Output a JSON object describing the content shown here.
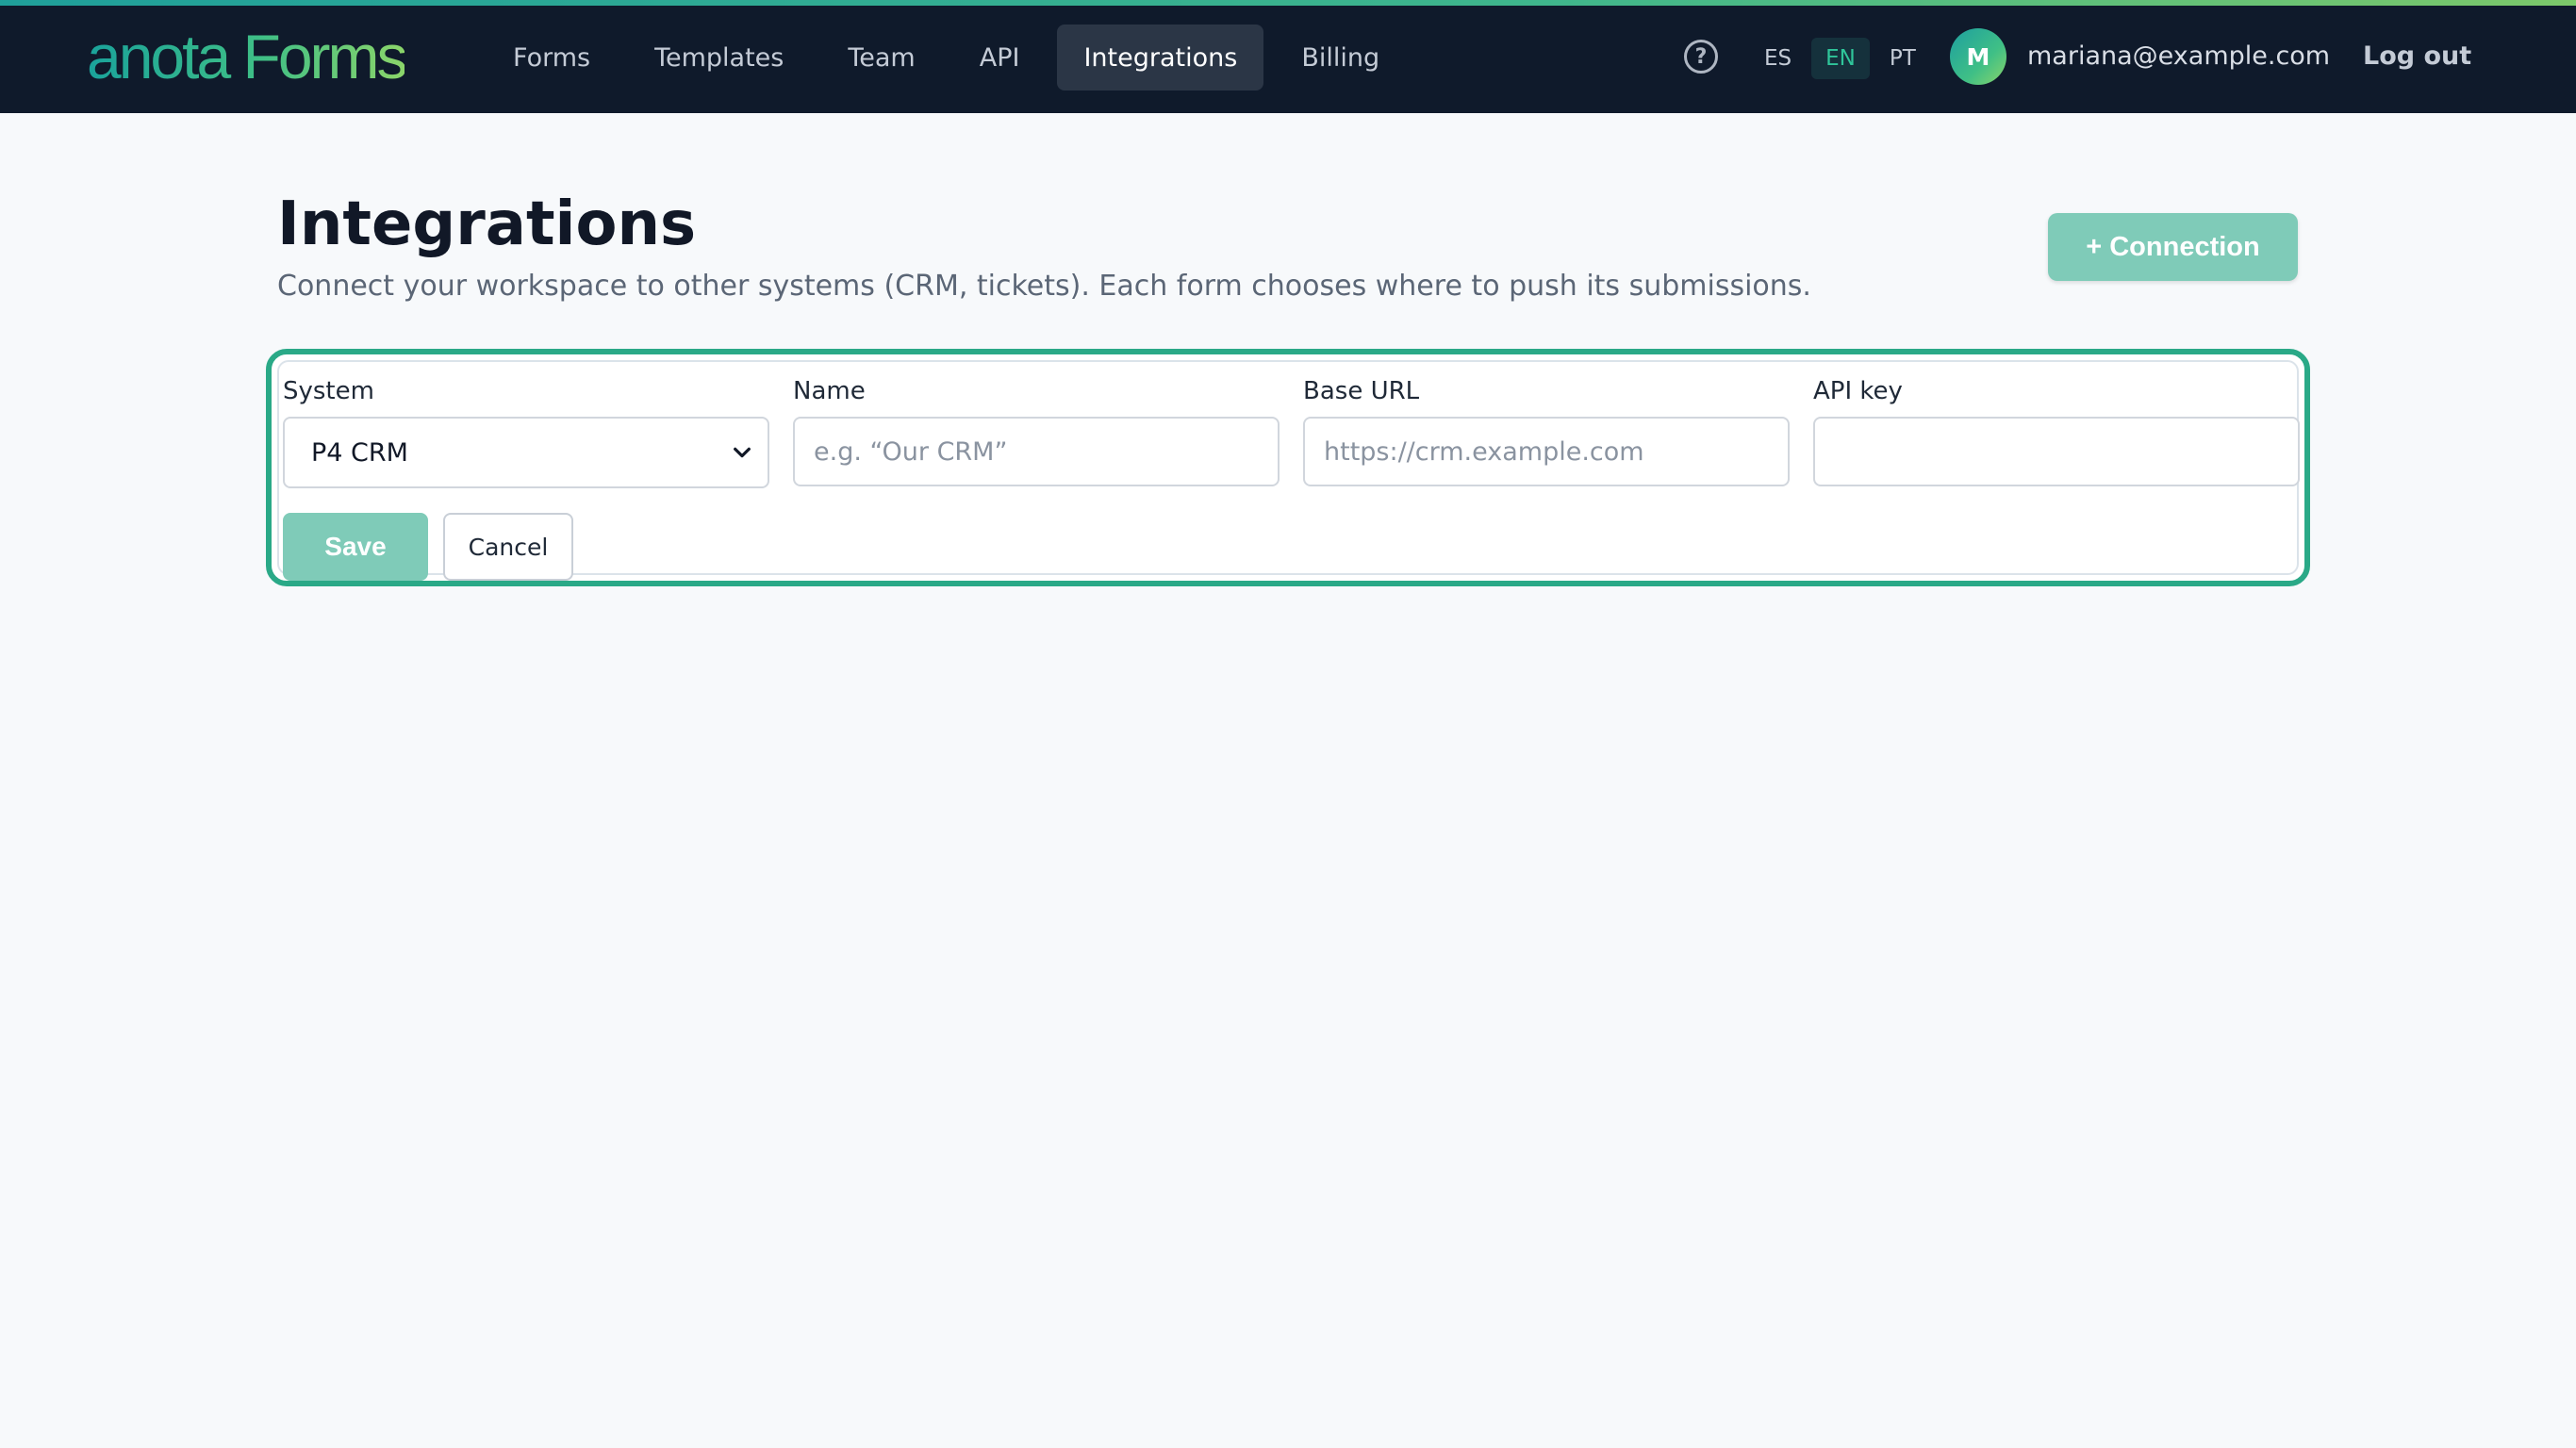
{
  "header": {
    "logo": "anota Forms",
    "nav": [
      "Forms",
      "Templates",
      "Team",
      "API",
      "Integrations",
      "Billing"
    ],
    "active_nav": "Integrations",
    "help_glyph": "?",
    "languages": [
      "ES",
      "EN",
      "PT"
    ],
    "active_language": "EN",
    "avatar_initial": "M",
    "email": "mariana@example.com",
    "logout": "Log out"
  },
  "page": {
    "title": "Integrations",
    "subtitle": "Connect your workspace to other systems (CRM, tickets). Each form chooses where to push its submissions.",
    "add_button": "+ Connection"
  },
  "form": {
    "system_label": "System",
    "system_value": "P4 CRM",
    "name_label": "Name",
    "name_placeholder": "e.g. “Our CRM”",
    "base_url_label": "Base URL",
    "base_url_placeholder": "https://crm.example.com",
    "api_key_label": "API key",
    "api_key_value": "",
    "save_label": "Save",
    "cancel_label": "Cancel"
  },
  "colors": {
    "topbar": "#0f1a2b",
    "accent": "#2aa987",
    "button": "#7fcbb8"
  },
  "icons": {
    "help": "question-circle-icon",
    "select": "chevron-down-icon"
  }
}
